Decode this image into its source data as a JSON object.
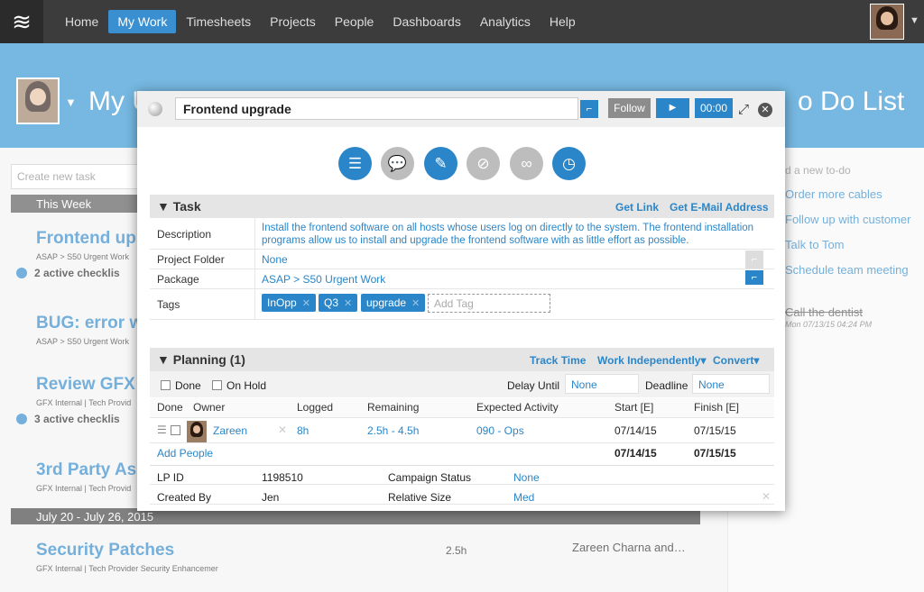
{
  "nav": {
    "items": [
      "Home",
      "My Work",
      "Timesheets",
      "Projects",
      "People",
      "Dashboards",
      "Analytics",
      "Help"
    ],
    "active_index": 1
  },
  "banner": {
    "title_left": "My U",
    "title_right": "o Do List"
  },
  "left": {
    "create_placeholder": "Create new task",
    "week1": "This Week",
    "tasks": [
      {
        "title": "Frontend up",
        "sub": "ASAP  >  S50 Urgent Work",
        "check": "2 active checklis"
      },
      {
        "title": "BUG: error w",
        "sub": "ASAP  >  S50 Urgent Work",
        "check": ""
      },
      {
        "title": "Review GFX",
        "sub": "GFX Internal  |  Tech Provid",
        "check": "3 active checklis"
      },
      {
        "title": "3rd Party As",
        "sub": "GFX Internal  |  Tech Provid",
        "check": ""
      }
    ],
    "week2": "July 20 - July 26, 2015",
    "bottom_task": {
      "title": "Security Patches",
      "sub": "GFX Internal  |  Tech Provider Security Enhancemer",
      "hours": "2.5h",
      "people": "Zareen Charna and…"
    }
  },
  "right": {
    "add_placeholder": "d a new to-do",
    "todos": [
      "Order more cables",
      "Follow up with customer",
      "Talk to Tom",
      "Schedule team meeting"
    ],
    "done_item": "Call the dentist",
    "done_meta": "Mon 07/13/15 04:24 PM"
  },
  "modal": {
    "title": "Frontend upgrade",
    "follow": "Follow",
    "play": "▶",
    "timer": "00:00",
    "icons": [
      "list-icon",
      "comments-icon",
      "edit-icon",
      "attachment-icon",
      "link-icon",
      "clock-icon"
    ],
    "task_section": {
      "title": "▼ Task",
      "get_link": "Get Link",
      "get_email": "Get E-Mail Address"
    },
    "description_label": "Description",
    "description": "Install the frontend software on all hosts whose users log on directly to the system. The frontend installation programs allow us to install and upgrade the frontend software with as little effort as possible.",
    "project_folder_label": "Project Folder",
    "project_folder": "None",
    "package_label": "Package",
    "package": "ASAP  >  S50 Urgent Work",
    "tags_label": "Tags",
    "tags": [
      "InOpp",
      "Q3",
      "upgrade"
    ],
    "add_tag": "Add Tag",
    "planning": {
      "title": "▼ Planning (1)",
      "track_time": "Track Time",
      "work_independently": "Work Independently▾",
      "convert": "Convert▾"
    },
    "done_label": "Done",
    "on_hold_label": "On Hold",
    "delay_until_label": "Delay Until",
    "delay_until": "None",
    "deadline_label": "Deadline",
    "deadline": "None",
    "grid_headers": [
      "Done",
      "Owner",
      "Logged",
      "Remaining",
      "Expected Activity",
      "Start [E]",
      "Finish [E]"
    ],
    "assignment": {
      "owner": "Zareen",
      "logged": "8h",
      "remaining": "2.5h - 4.5h",
      "activity": "090 - Ops",
      "start": "07/14/15",
      "finish": "07/15/15"
    },
    "add_people": "Add People",
    "total_start": "07/14/15",
    "total_finish": "07/15/15",
    "lp_id_label": "LP ID",
    "lp_id": "1198510",
    "campaign_status_label": "Campaign Status",
    "campaign_status": "None",
    "created_by_label": "Created By",
    "created_by": "Jen",
    "relative_size_label": "Relative Size",
    "relative_size": "Med"
  }
}
